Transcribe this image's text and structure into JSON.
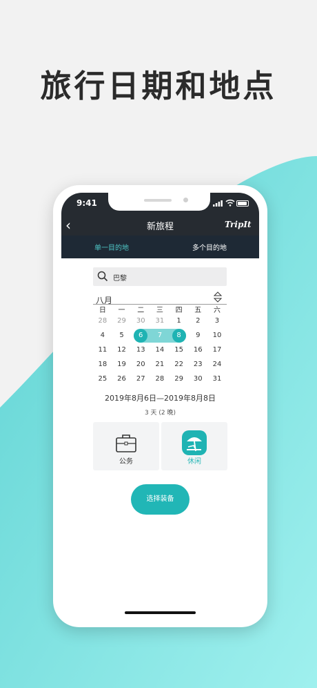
{
  "headline": "旅行日期和地点",
  "status": {
    "time": "9:41"
  },
  "nav": {
    "title": "新旅程",
    "logo": "TripIt"
  },
  "tabs": [
    "单一目的地",
    "多个目的地"
  ],
  "search": {
    "value": "巴黎"
  },
  "calendar": {
    "month": "八月",
    "weekdays": [
      "日",
      "一",
      "二",
      "三",
      "四",
      "五",
      "六"
    ],
    "weeks": [
      [
        "28",
        "29",
        "30",
        "31",
        "1",
        "2",
        "3"
      ],
      [
        "4",
        "5",
        "6",
        "7",
        "8",
        "9",
        "10"
      ],
      [
        "11",
        "12",
        "13",
        "14",
        "15",
        "16",
        "17"
      ],
      [
        "18",
        "19",
        "20",
        "21",
        "22",
        "23",
        "24"
      ],
      [
        "25",
        "26",
        "27",
        "28",
        "29",
        "30",
        "31"
      ]
    ],
    "selected_start": "6",
    "selected_end": "8"
  },
  "date_range": "2019年8月6日—2019年8月8日",
  "nights": "3 天 (2 晚)",
  "trip_types": [
    {
      "label": "公务",
      "icon": "briefcase-icon",
      "selected": false
    },
    {
      "label": "休闲",
      "icon": "beach-umbrella-icon",
      "selected": true
    }
  ],
  "cta": "选择装备",
  "colors": {
    "accent": "#1fb3b3",
    "dark": "#262b31",
    "wave": "#7fe0e0"
  }
}
